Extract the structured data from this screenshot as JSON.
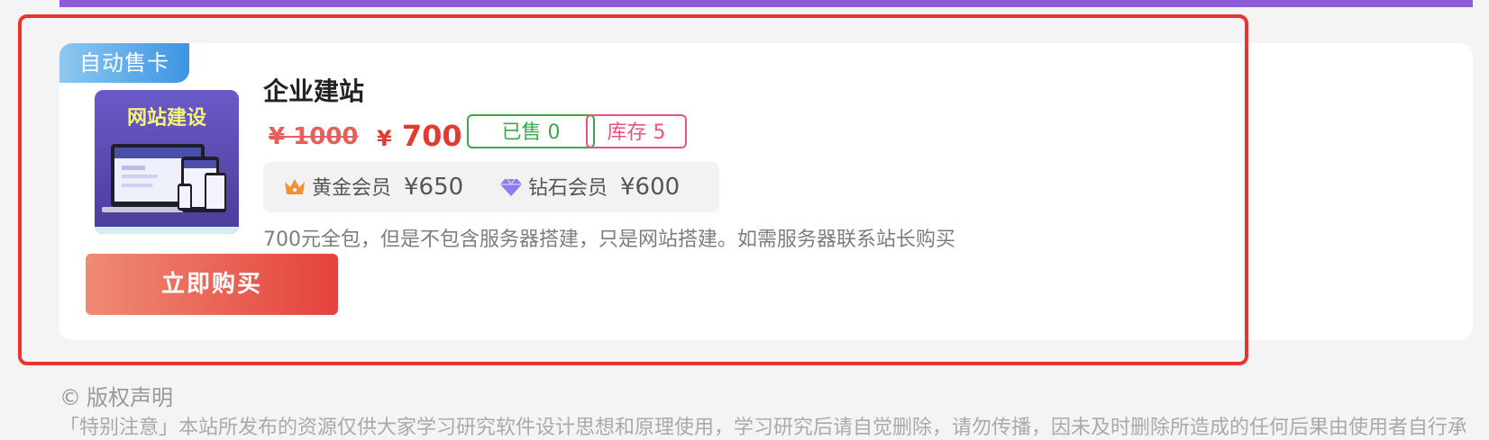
{
  "product": {
    "badge": "自动售卡",
    "image_caption": "网站建设",
    "title": "企业建站",
    "original_price": "¥ 1000",
    "currency": "¥",
    "price": "700",
    "sold_label": "已售 0",
    "stock_label": "库存 5",
    "members": [
      {
        "name": "黄金会员",
        "price": "¥650",
        "icon": "crown-icon"
      },
      {
        "name": "钻石会员",
        "price": "¥600",
        "icon": "diamond-icon"
      }
    ],
    "description": "700元全包，但是不包含服务器搭建，只是网站搭建。如需服务器联系站长购买",
    "buy_label": "立即购买"
  },
  "footer": {
    "copyright_icon": "©",
    "copyright_title": "版权声明",
    "notice": "「特别注意」本站所发布的资源仅供大家学习研究软件设计思想和原理使用，学习研究后请自觉删除，请勿传播，因未及时删除所造成的任何后果由使用者自行承担。"
  },
  "colors": {
    "accent_purple": "#8e5bd6",
    "badge_blue": "#3d94e3",
    "price_red": "#e23b33",
    "sold_green": "#3ea64a",
    "stock_pink": "#e8557a",
    "highlight_red": "#e8352e"
  }
}
